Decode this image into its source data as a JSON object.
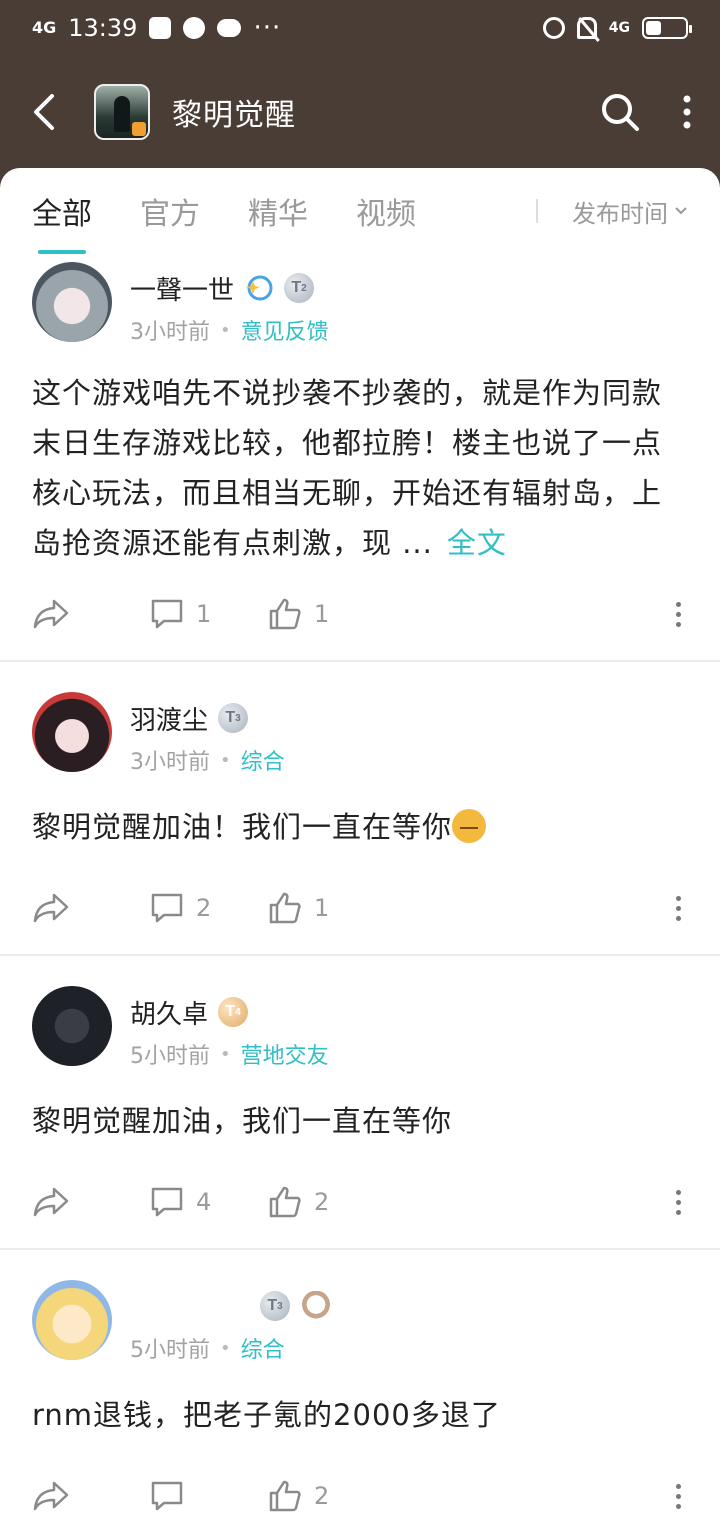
{
  "status_bar": {
    "signal": "4G",
    "time": "13:39",
    "network": "4G"
  },
  "app_bar": {
    "title": "黎明觉醒"
  },
  "tabs": [
    {
      "label": "全部",
      "active": true
    },
    {
      "label": "官方",
      "active": false
    },
    {
      "label": "精华",
      "active": false
    },
    {
      "label": "视频",
      "active": false
    }
  ],
  "sort": {
    "label": "发布时间"
  },
  "posts": [
    {
      "username": "一聲一世",
      "level": "T",
      "level_num": "2",
      "time": "3小时前",
      "forum": "意见反馈",
      "content": "这个游戏咱先不说抄袭不抄袭的，就是作为同款末日生存游戏比较，他都拉胯！楼主也说了一点核心玩法，而且相当无聊，开始还有辐射岛，上岛抢资源还能有点刺激，现 ...",
      "read_more": "全文",
      "comments": "1",
      "likes": "1"
    },
    {
      "username": "羽渡尘",
      "level": "T",
      "level_num": "3",
      "time": "3小时前",
      "forum": "综合",
      "content": "黎明觉醒加油！我们一直在等你",
      "comments": "2",
      "likes": "1"
    },
    {
      "username": "胡久卓",
      "level": "T",
      "level_num": "4",
      "time": "5小时前",
      "forum": "营地交友",
      "content": "黎明觉醒加油，我们一直在等你",
      "comments": "4",
      "likes": "2"
    },
    {
      "username": "",
      "level": "T",
      "level_num": "3",
      "time": "5小时前",
      "forum": "综合",
      "content": "rnm退钱，把老子氪的2000多退了",
      "comments": "",
      "likes": "2"
    }
  ],
  "colors": {
    "accent": "#2fbfc5",
    "header_bg": "#4a3d36"
  }
}
